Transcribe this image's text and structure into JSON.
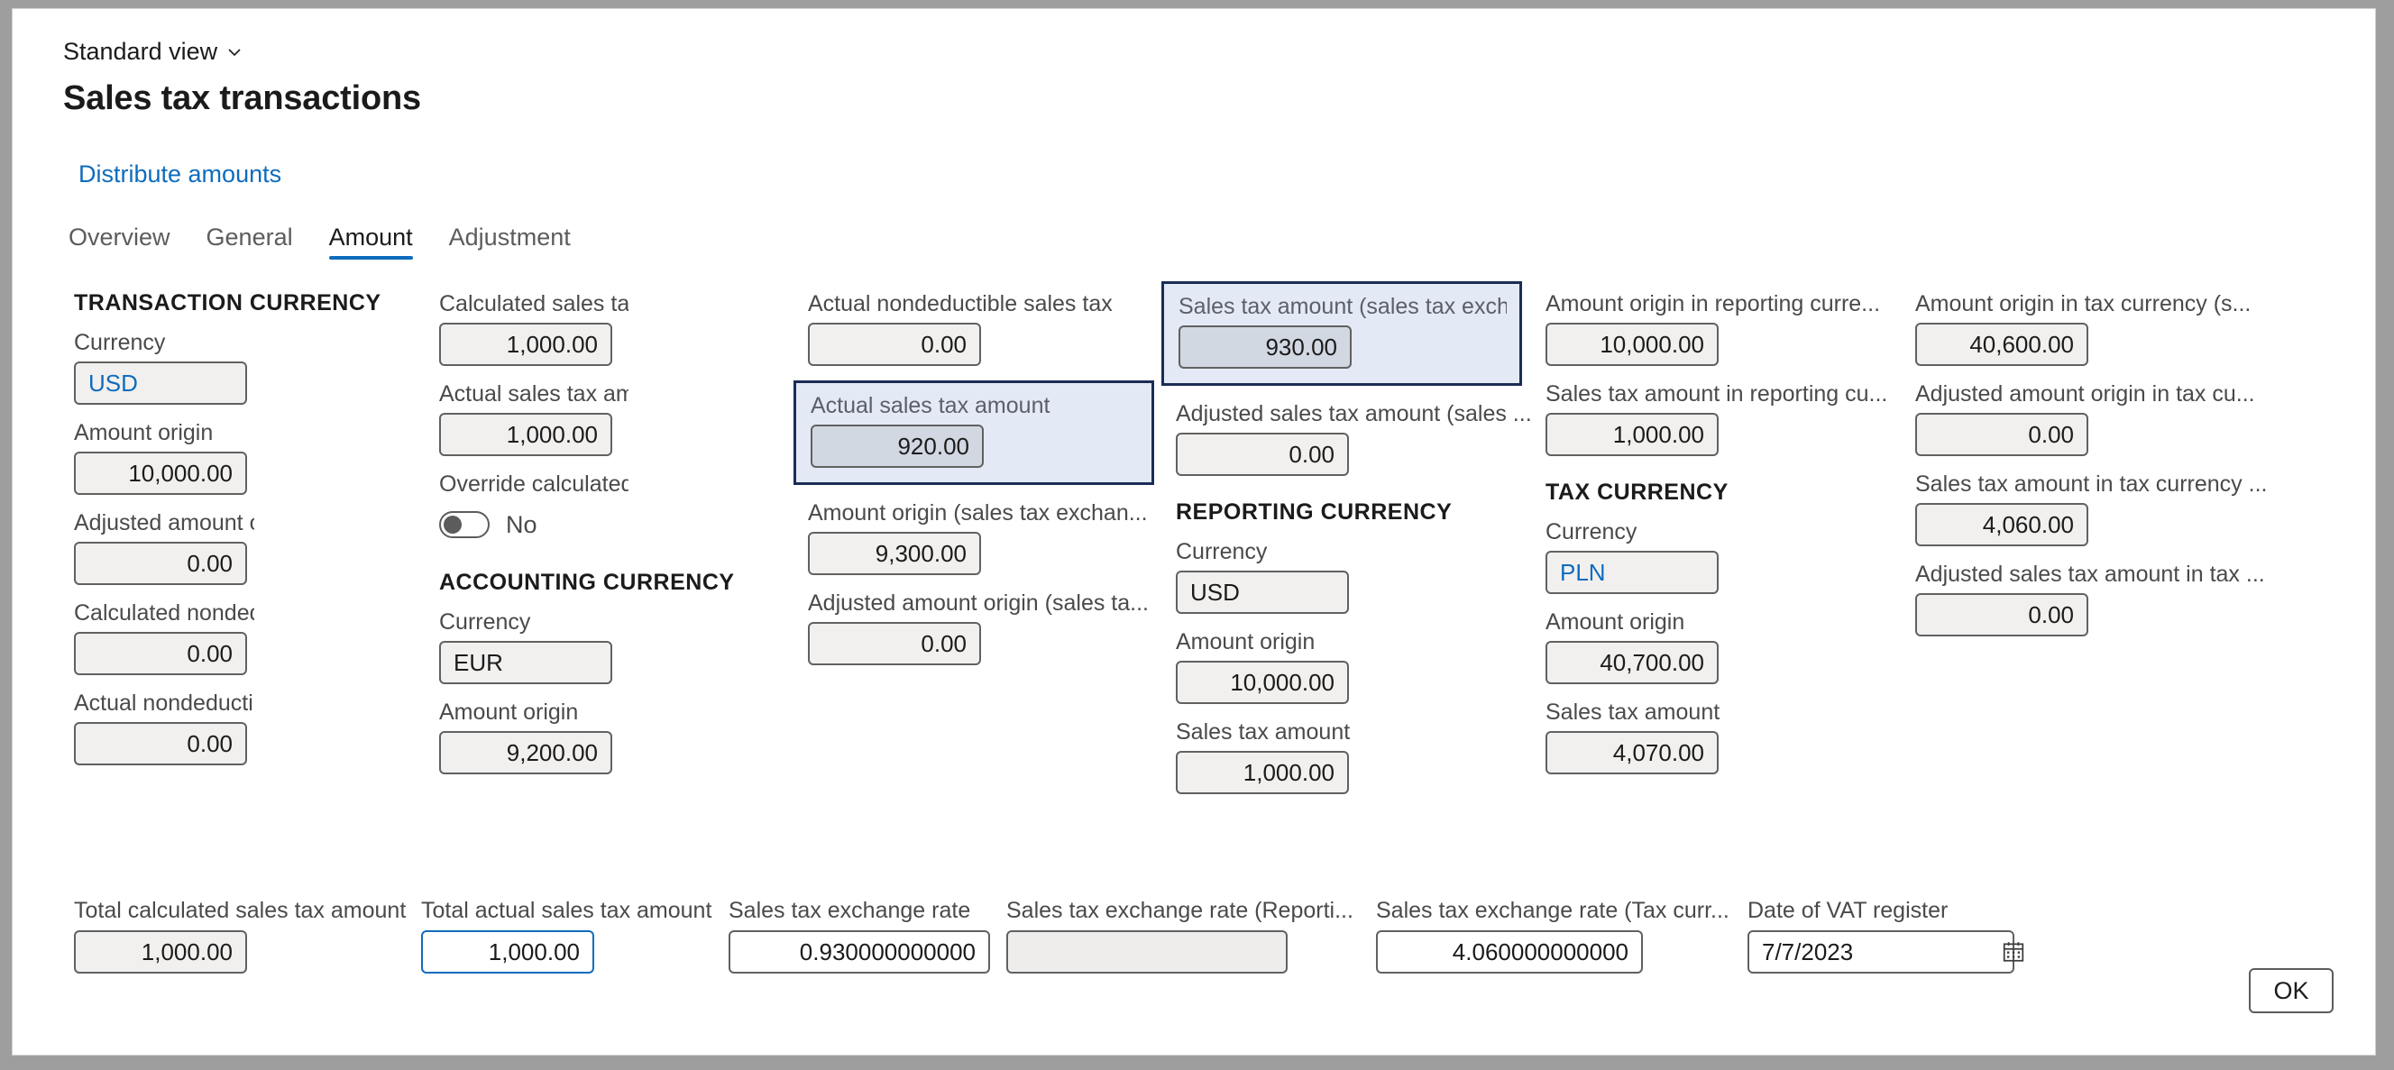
{
  "header": {
    "view_selector": "Standard view",
    "view_chevron_icon": "chevron-down-icon",
    "page_title": "Sales tax transactions",
    "action_distribute": "Distribute amounts"
  },
  "tabs": [
    {
      "label": "Overview",
      "active": false
    },
    {
      "label": "General",
      "active": false
    },
    {
      "label": "Amount",
      "active": true
    },
    {
      "label": "Adjustment",
      "active": false
    }
  ],
  "col1": {
    "section": "TRANSACTION CURRENCY",
    "fields": [
      {
        "label": "Currency",
        "value": "USD"
      },
      {
        "label": "Amount origin",
        "value": "10,000.00"
      },
      {
        "label": "Adjusted amount origin",
        "value": "0.00"
      },
      {
        "label": "Calculated nondeductible sales tax",
        "value": "0.00"
      },
      {
        "label": "Actual nondeductible sales tax",
        "value": "0.00"
      }
    ]
  },
  "col2": {
    "fields": [
      {
        "label": "Calculated sales tax amount",
        "value": "1,000.00"
      },
      {
        "label": "Actual sales tax amount",
        "value": "1,000.00"
      }
    ],
    "toggle": {
      "label": "Override calculated sales tax",
      "state": "No"
    },
    "section": "ACCOUNTING CURRENCY",
    "acct_fields": [
      {
        "label": "Currency",
        "value": "EUR"
      },
      {
        "label": "Amount origin",
        "value": "9,200.00"
      }
    ]
  },
  "col3": {
    "fields": [
      {
        "label": "Actual nondeductible sales tax",
        "value": "0.00"
      },
      {
        "label": "Actual sales tax amount",
        "value": "920.00"
      },
      {
        "label": "Amount origin (sales tax exchan...",
        "value": "9,300.00"
      },
      {
        "label": "Adjusted amount origin (sales ta...",
        "value": "0.00"
      }
    ]
  },
  "col4": {
    "fields": [
      {
        "label": "Sales tax amount (sales tax excha...",
        "value": "930.00"
      },
      {
        "label": "Adjusted sales tax amount (sales ...",
        "value": "0.00"
      }
    ],
    "section": "REPORTING CURRENCY",
    "rep_fields": [
      {
        "label": "Currency",
        "value": "USD"
      },
      {
        "label": "Amount origin",
        "value": "10,000.00"
      },
      {
        "label": "Sales tax amount",
        "value": "1,000.00"
      }
    ]
  },
  "col5": {
    "fields": [
      {
        "label": "Amount origin in reporting curre...",
        "value": "10,000.00"
      },
      {
        "label": "Sales tax amount in reporting cu...",
        "value": "1,000.00"
      }
    ],
    "section": "TAX CURRENCY",
    "tax_fields": [
      {
        "label": "Currency",
        "value": "PLN"
      },
      {
        "label": "Amount origin",
        "value": "40,700.00"
      },
      {
        "label": "Sales tax amount",
        "value": "4,070.00"
      }
    ]
  },
  "col6": {
    "fields": [
      {
        "label": "Amount origin in tax currency (s...",
        "value": "40,600.00"
      },
      {
        "label": "Adjusted amount origin in tax cu...",
        "value": "0.00"
      },
      {
        "label": "Sales tax amount in tax currency ...",
        "value": "4,060.00"
      },
      {
        "label": "Adjusted sales tax amount in tax ...",
        "value": "0.00"
      }
    ]
  },
  "bottom": {
    "total_calculated": {
      "label": "Total calculated sales tax amount",
      "value": "1,000.00"
    },
    "total_actual": {
      "label": "Total actual sales tax amount",
      "value": "1,000.00"
    },
    "rate": {
      "label": "Sales tax exchange rate",
      "value": "0.930000000000"
    },
    "rate_reporting": {
      "label": "Sales tax exchange rate (Reporti...",
      "value": ""
    },
    "rate_tax": {
      "label": "Sales tax exchange rate (Tax curr...",
      "value": "4.060000000000"
    },
    "vat_date": {
      "label": "Date of VAT register",
      "value": "7/7/2023",
      "icon": "calendar-icon"
    }
  },
  "footer": {
    "ok_label": "OK"
  },
  "colors": {
    "accent": "#0f6cbd",
    "highlight_bg": "#e3eaf5",
    "highlight_border": "#1b2d55",
    "field_bg": "#f1f0ef",
    "selected_field_bg": "#d2d8e2"
  }
}
